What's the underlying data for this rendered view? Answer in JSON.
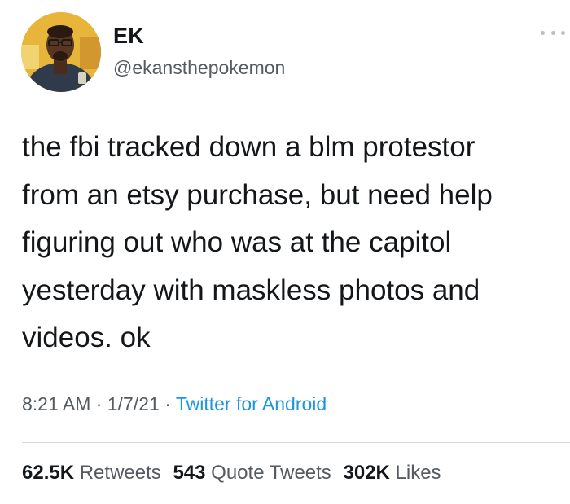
{
  "author": {
    "display_name": "EK",
    "handle": "@ekansthepokemon"
  },
  "more_icon": "more-horizontal-icon",
  "tweet": {
    "text": "the fbi tracked down a blm protestor\nfrom an etsy purchase, but need help\nfiguring out who was at the capitol\nyesterday with maskless photos and\nvideos. ok"
  },
  "meta": {
    "time": "8:21 AM",
    "separator": "·",
    "date": "1/7/21",
    "source": "Twitter for Android"
  },
  "stats": {
    "retweets_count": "62.5K",
    "retweets_label": "Retweets",
    "quotes_count": "543",
    "quotes_label": "Quote Tweets",
    "likes_count": "302K",
    "likes_label": "Likes"
  },
  "colors": {
    "link": "#1b95e0",
    "text": "#14171a",
    "secondary": "#555b60",
    "divider": "#d6dadd"
  }
}
